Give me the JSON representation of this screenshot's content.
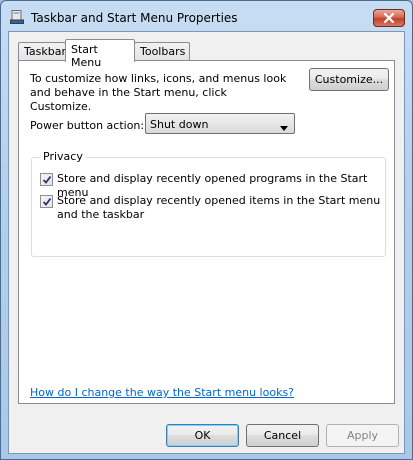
{
  "window": {
    "title": "Taskbar and Start Menu Properties",
    "icon": "taskbar-properties-icon",
    "close_icon": "close-icon"
  },
  "tabs": [
    {
      "label": "Taskbar",
      "active": false
    },
    {
      "label": "Start Menu",
      "active": true
    },
    {
      "label": "Toolbars",
      "active": false
    }
  ],
  "start_menu": {
    "description": "To customize how links, icons, and menus look and behave in the Start menu, click Customize.",
    "customize_label": "Customize...",
    "power_label": "Power button action:",
    "power_value": "Shut down",
    "privacy": {
      "title": "Privacy",
      "items": [
        {
          "label": "Store and display recently opened programs in the Start menu",
          "checked": true
        },
        {
          "label": "Store and display recently opened items in the Start menu and the taskbar",
          "checked": true
        }
      ]
    },
    "help_link": "How do I change the way the Start menu looks?"
  },
  "buttons": {
    "ok": "OK",
    "cancel": "Cancel",
    "apply": "Apply"
  },
  "colors": {
    "link": "#0066cc",
    "close_button": "#c0422b",
    "focus_border": "#3c7fb1"
  }
}
